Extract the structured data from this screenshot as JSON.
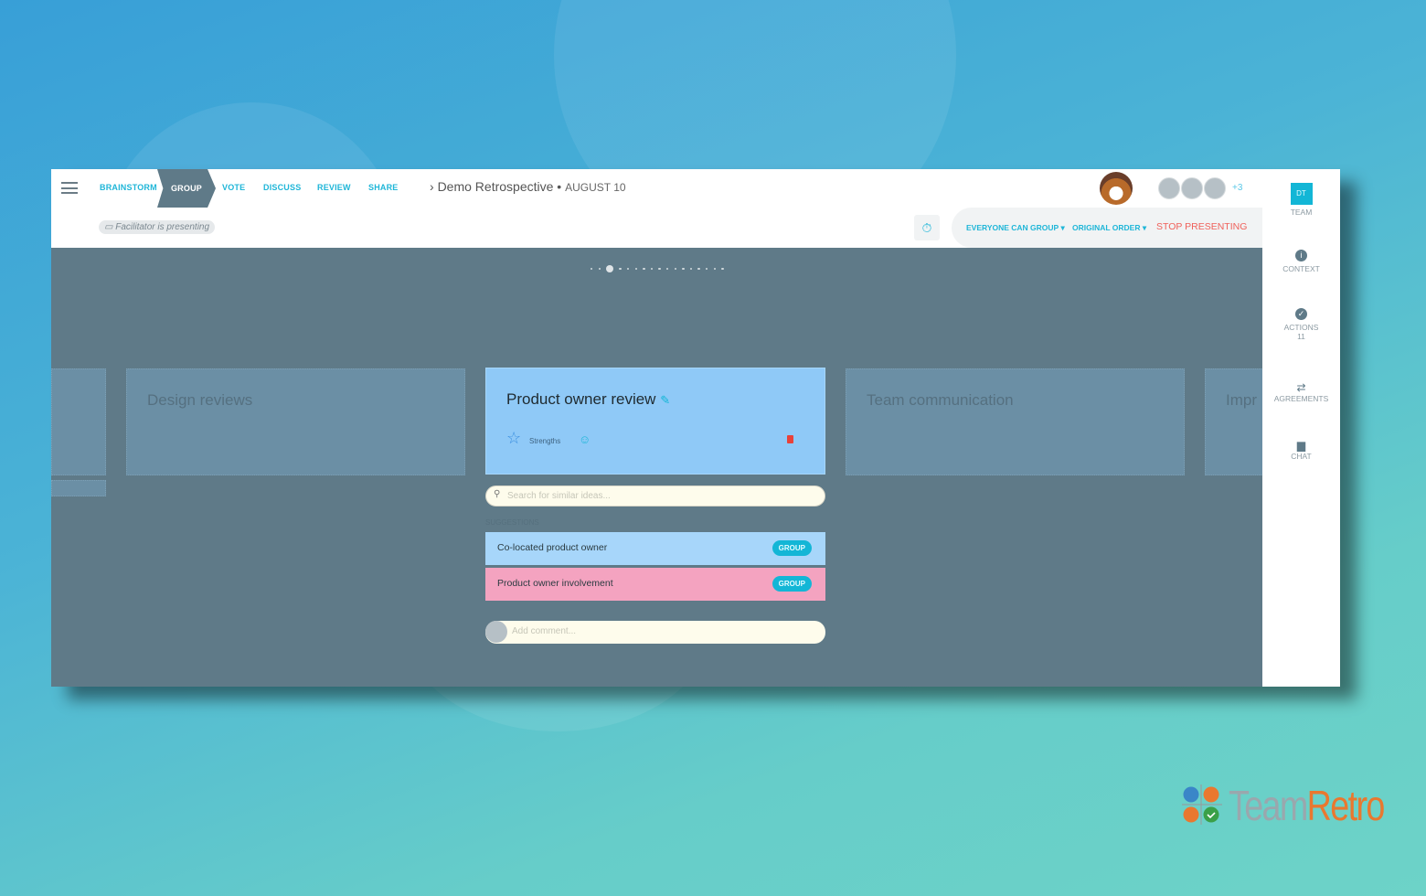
{
  "nav": {
    "steps": [
      "BRAINSTORM",
      "GROUP",
      "VOTE",
      "DISCUSS",
      "REVIEW",
      "SHARE"
    ],
    "active": "GROUP"
  },
  "header": {
    "title": "Demo Retrospective",
    "date": "AUGUST 10",
    "presenting": "Facilitator is presenting",
    "extra_participants": "+3"
  },
  "toolbar": {
    "group_mode": "EVERYONE CAN GROUP",
    "order": "ORIGINAL ORDER",
    "stop": "STOP PRESENTING"
  },
  "carousel": {
    "total": 17,
    "active_index": 2
  },
  "columns": {
    "left": "Design reviews",
    "right": "Team communication",
    "far_right": "Impr"
  },
  "card": {
    "title": "Product owner review",
    "category": "Strengths"
  },
  "search": {
    "placeholder": "Search for similar ideas..."
  },
  "suggestions": {
    "label": "SUGGESTIONS",
    "items": [
      {
        "text": "Co-located product owner",
        "button": "GROUP",
        "color": "#a7d6fa"
      },
      {
        "text": "Product owner involvement",
        "button": "GROUP",
        "color": "#f4a3c0"
      }
    ]
  },
  "comment": {
    "placeholder": "Add comment..."
  },
  "sidebar": {
    "team_badge": "DT",
    "items": [
      {
        "label": "TEAM"
      },
      {
        "label": "CONTEXT"
      },
      {
        "label": "ACTIONS",
        "count": "11"
      },
      {
        "label": "AGREEMENTS"
      },
      {
        "label": "CHAT"
      }
    ]
  },
  "brand": {
    "name_a": "Team",
    "name_b": "Retro"
  },
  "colors": {
    "accent": "#1fb6d8",
    "danger": "#f0605a",
    "card": "#8fc9f7"
  }
}
